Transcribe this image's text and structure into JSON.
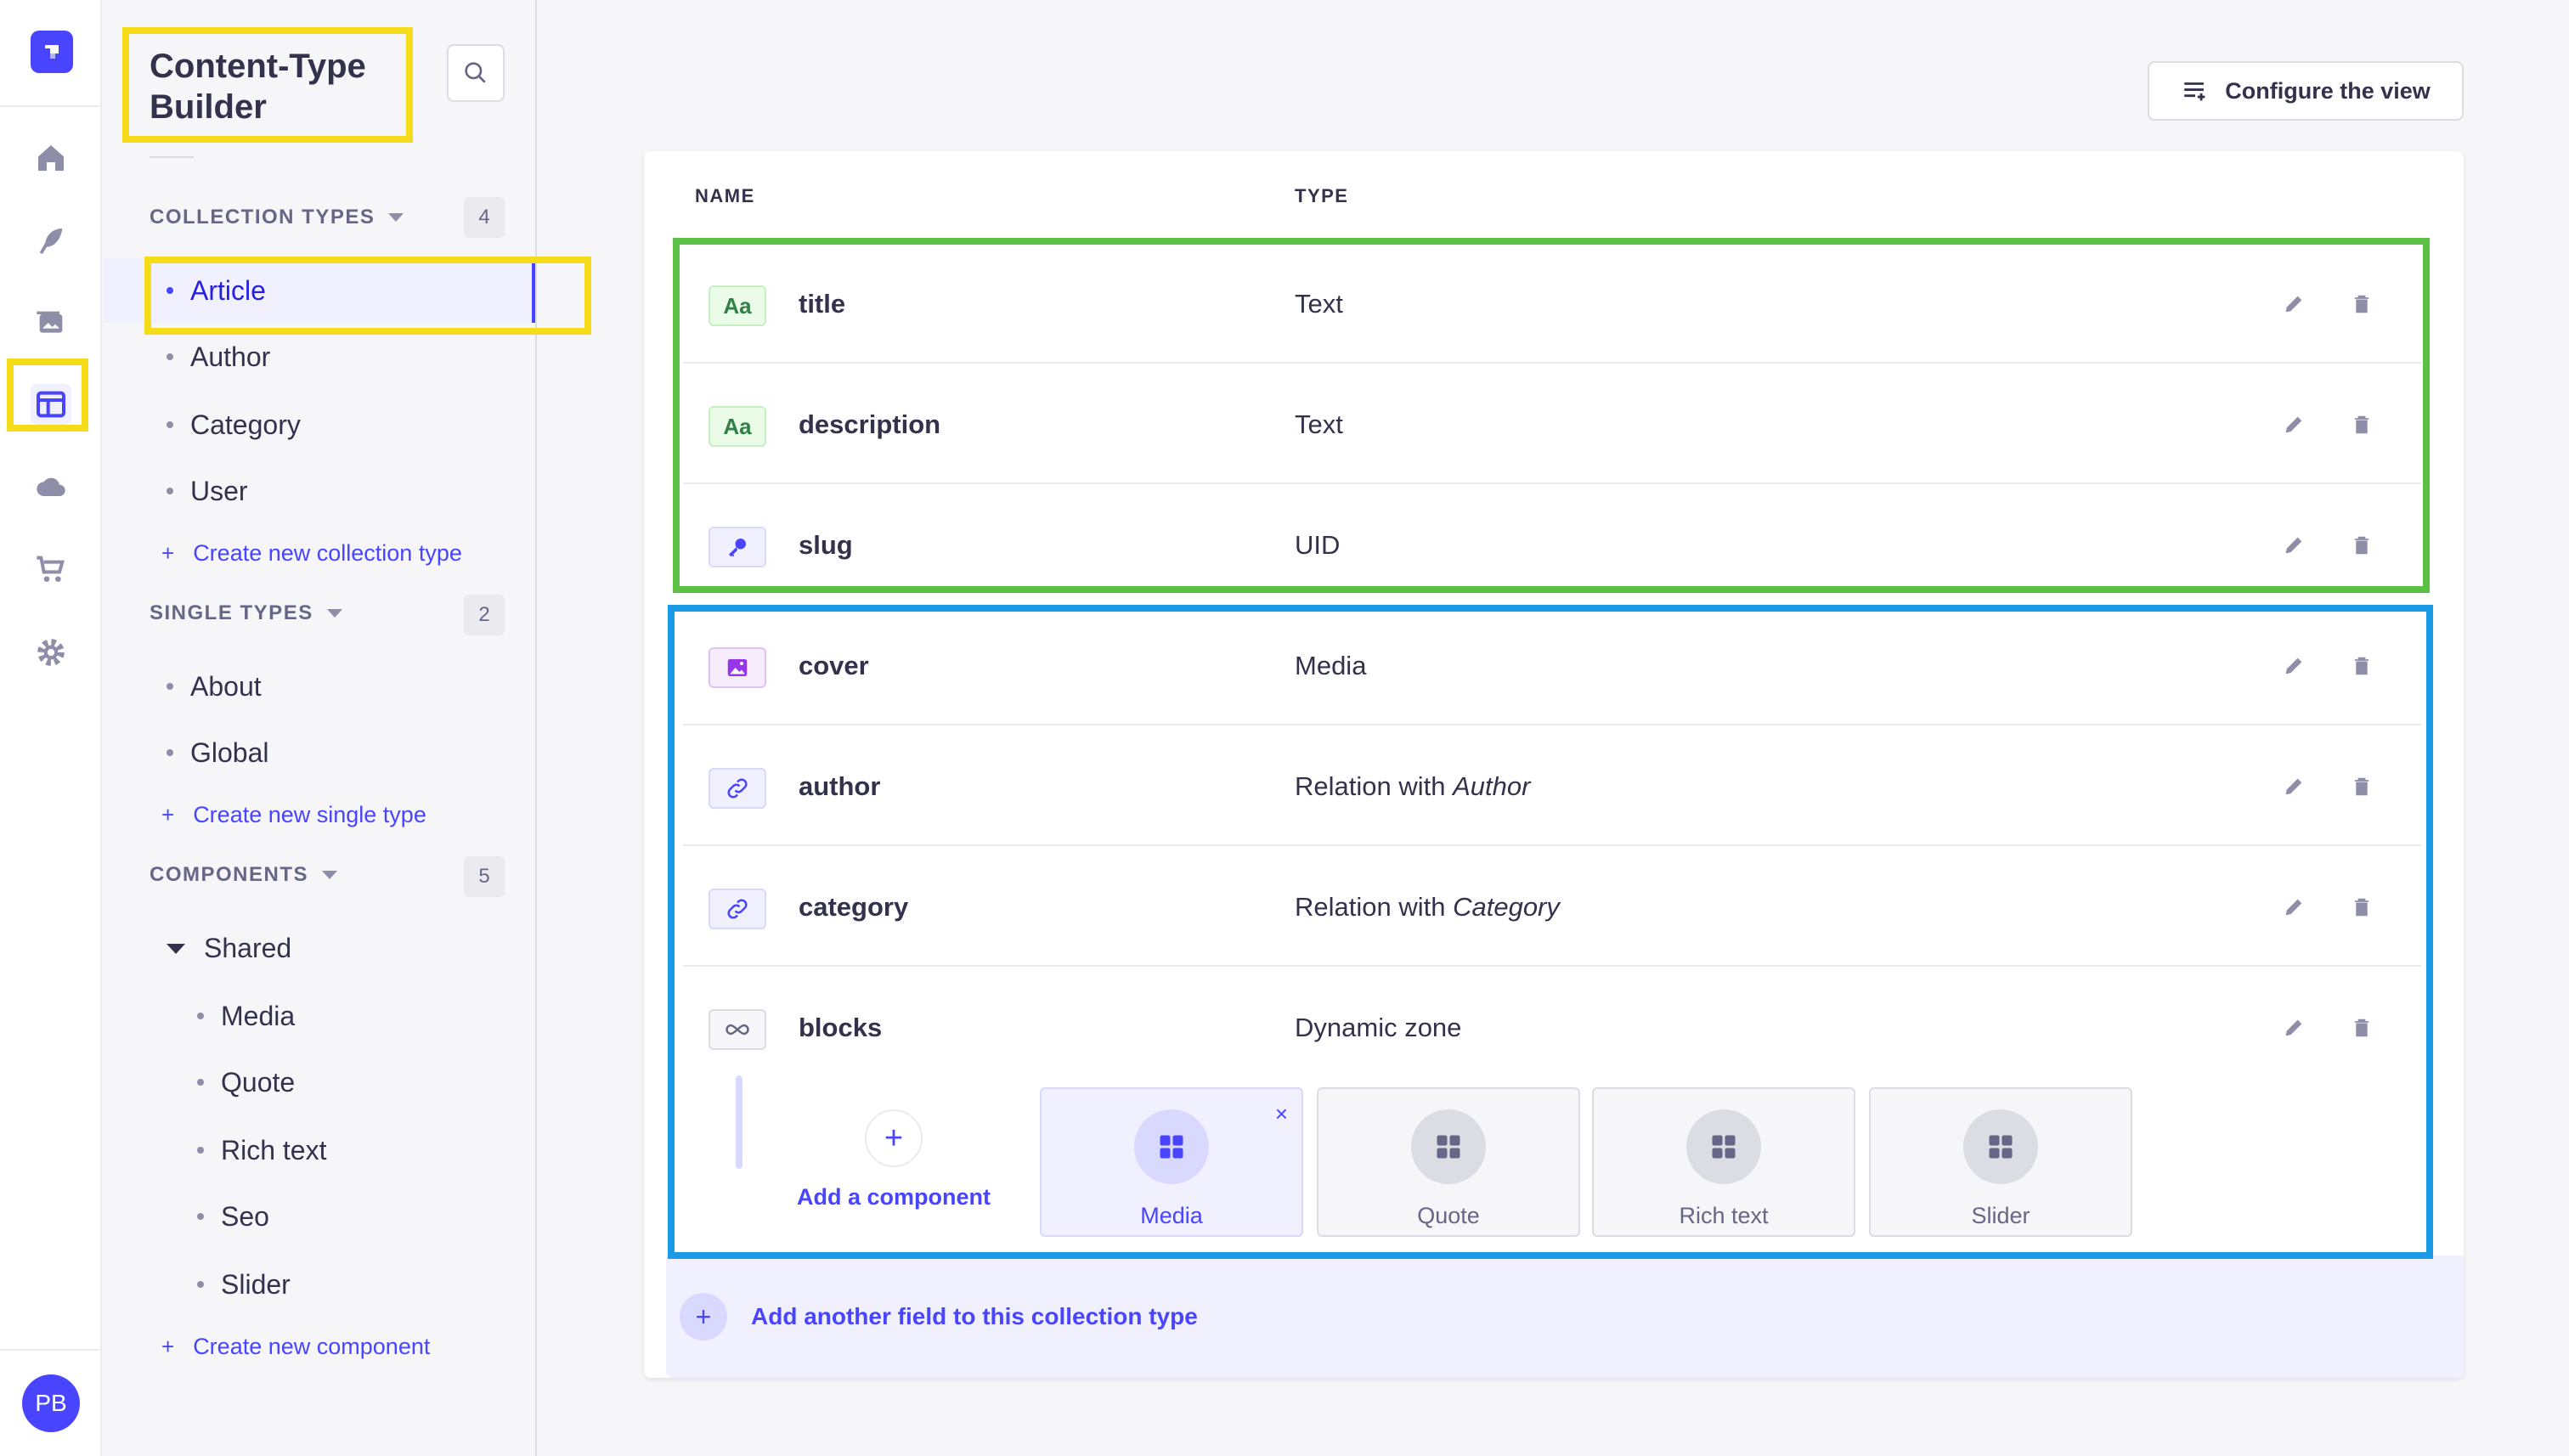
{
  "sidebar": {
    "title_line1": "Content-Type",
    "title_line2": "Builder",
    "sections": {
      "collection": {
        "label": "COLLECTION TYPES",
        "count": "4"
      },
      "single": {
        "label": "SINGLE TYPES",
        "count": "2"
      },
      "components": {
        "label": "COMPONENTS",
        "count": "5"
      }
    },
    "collection_items": [
      "Article",
      "Author",
      "Category",
      "User"
    ],
    "create_collection": "Create new collection type",
    "single_items": [
      "About",
      "Global"
    ],
    "create_single": "Create new single type",
    "component_group": "Shared",
    "component_items": [
      "Media",
      "Quote",
      "Rich text",
      "Seo",
      "Slider"
    ],
    "create_component": "Create new component"
  },
  "user": {
    "initials": "PB"
  },
  "toolbar": {
    "configure_label": "Configure the view"
  },
  "table": {
    "headers": {
      "name": "NAME",
      "type": "TYPE"
    },
    "rows": [
      {
        "name": "title",
        "type": "Text",
        "icon": "Aa"
      },
      {
        "name": "description",
        "type": "Text",
        "icon": "Aa"
      },
      {
        "name": "slug",
        "type": "UID",
        "icon": "key-icon"
      },
      {
        "name": "cover",
        "type": "Media",
        "icon": "image-icon"
      },
      {
        "name": "author",
        "type_prefix": "Relation with ",
        "type_target": "Author",
        "icon": "link-icon"
      },
      {
        "name": "category",
        "type_prefix": "Relation with ",
        "type_target": "Category",
        "icon": "link-icon"
      },
      {
        "name": "blocks",
        "type": "Dynamic zone",
        "icon": "infinity-icon"
      }
    ]
  },
  "dynamic_zone": {
    "add_label": "Add a component",
    "components": [
      "Media",
      "Quote",
      "Rich text",
      "Slider"
    ],
    "close_glyph": "×"
  },
  "footer": {
    "add_field_label": "Add another field to this collection type"
  },
  "colors": {
    "primary": "#4945ff",
    "highlight_yellow": "#f5dc1a",
    "highlight_green": "#5cc044",
    "highlight_blue": "#1a9ae6"
  }
}
